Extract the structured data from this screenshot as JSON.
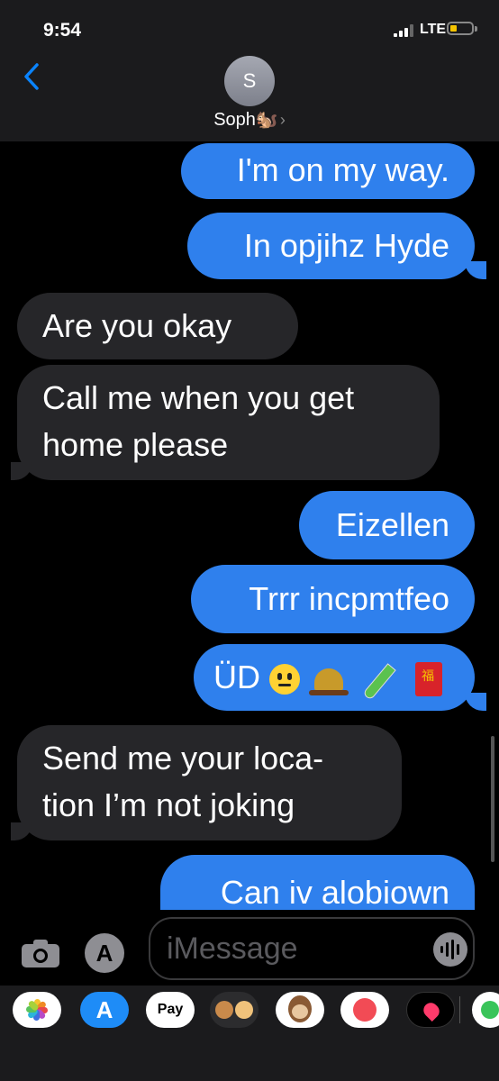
{
  "status_bar": {
    "time": "9:54",
    "network": "LTE",
    "battery_color": "#f5c400"
  },
  "header": {
    "avatar_initial": "S",
    "contact_name": "Soph🐿️",
    "contact_chevron": "›"
  },
  "messages": [
    {
      "direction": "outgoing",
      "lines": [
        "I'm on my way."
      ]
    },
    {
      "direction": "outgoing",
      "lines": [
        "In opjihz Hyde"
      ]
    },
    {
      "direction": "incoming",
      "lines": [
        "Are you okay"
      ]
    },
    {
      "direction": "incoming",
      "lines": [
        "Call me when you get",
        "home please"
      ]
    },
    {
      "direction": "outgoing",
      "lines": [
        "Eizellen"
      ]
    },
    {
      "direction": "outgoing",
      "lines": [
        "Trrr incpmtfeo"
      ]
    },
    {
      "direction": "outgoing",
      "text": "ÜD",
      "emojis": [
        "slightly-smiling-face",
        "bellhop-bell",
        "test-tube",
        "red-envelope"
      ]
    },
    {
      "direction": "incoming",
      "lines": [
        "Send me your loca-",
        "tion I’m not joking"
      ]
    },
    {
      "direction": "outgoing",
      "lines": [
        "Can iv alobiown"
      ]
    }
  ],
  "input": {
    "placeholder": "iMessage"
  },
  "app_drawer": {
    "items": [
      {
        "name": "photos-app",
        "icon": "photos-icon"
      },
      {
        "name": "app-store-app",
        "icon": "app-store-icon"
      },
      {
        "name": "apple-pay-app",
        "label": "Pay"
      },
      {
        "name": "memoji-stickers-app",
        "icon": "memoji-icon"
      },
      {
        "name": "animoji-app",
        "icon": "monkey-icon"
      },
      {
        "name": "web-images-app",
        "icon": "web-search-icon"
      },
      {
        "name": "digital-touch-app",
        "icon": "heart-icon"
      },
      {
        "name": "more-apps",
        "icon": "sticker-app-icon"
      }
    ]
  },
  "colors": {
    "outgoing_bubble": "#2f80ed",
    "incoming_bubble": "#262629",
    "accent": "#0a84ff"
  }
}
